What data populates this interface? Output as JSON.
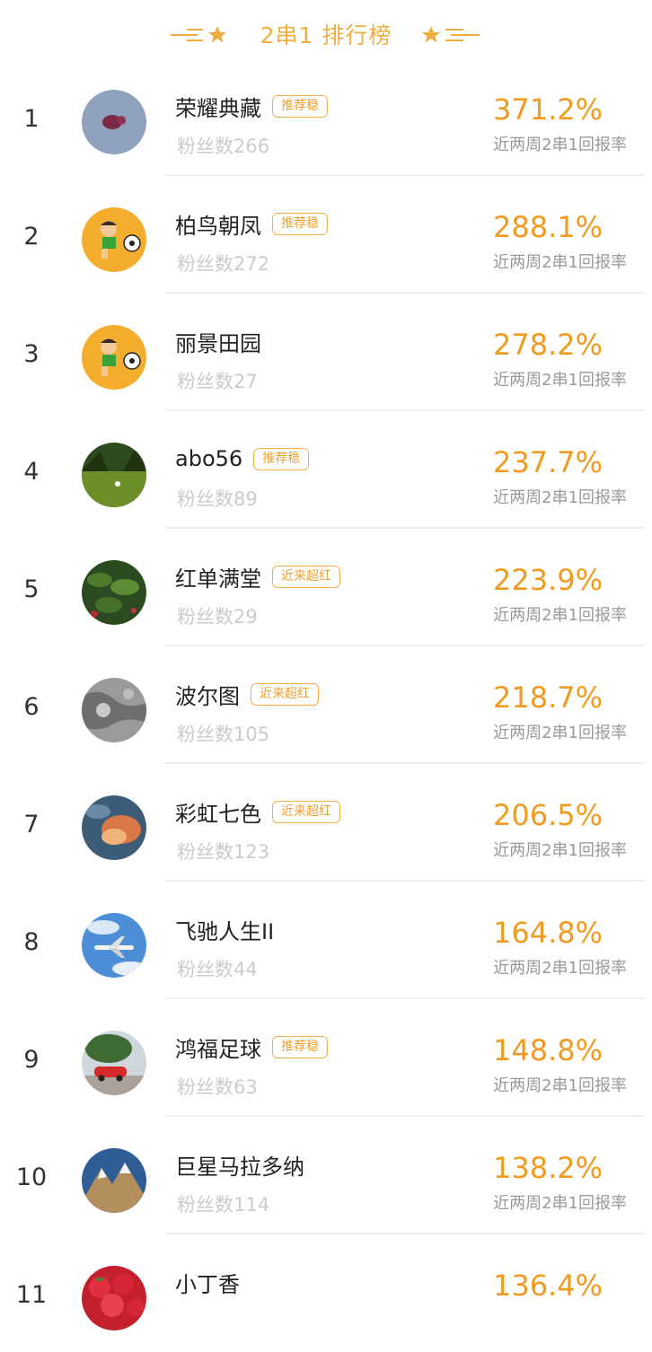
{
  "header": {
    "title": "2串1 排行榜"
  },
  "rate_label": "近近两周2串1回报率",
  "items": [
    {
      "rank": "1",
      "name": "荣耀典藏",
      "tag": "推荐稳",
      "fans": "粉丝数266",
      "rate": "371.2%",
      "rate_label": "近两周2串1回报率",
      "avatar": "pig-balloon-avatar-icon"
    },
    {
      "rank": "2",
      "name": "柏鸟朝凤",
      "tag": "推荐稳",
      "fans": "粉丝数272",
      "rate": "288.1%",
      "rate_label": "近两周2串1回报率",
      "avatar": "soccer-boy-avatar-icon"
    },
    {
      "rank": "3",
      "name": "丽景田园",
      "tag": "",
      "fans": "粉丝数27",
      "rate": "278.2%",
      "rate_label": "近两周2串1回报率",
      "avatar": "soccer-boy-avatar-icon"
    },
    {
      "rank": "4",
      "name": "abo56",
      "tag": "推荐稳",
      "fans": "粉丝数89",
      "rate": "237.7%",
      "rate_label": "近两周2串1回报率",
      "avatar": "field-avatar-icon"
    },
    {
      "rank": "5",
      "name": "红单满堂",
      "tag": "近来超红",
      "fans": "粉丝数29",
      "rate": "223.9%",
      "rate_label": "近两周2串1回报率",
      "avatar": "plant-avatar-icon"
    },
    {
      "rank": "6",
      "name": "波尔图",
      "tag": "近来超红",
      "fans": "粉丝数105",
      "rate": "218.7%",
      "rate_label": "近两周2串1回报率",
      "avatar": "stone-avatar-icon"
    },
    {
      "rank": "7",
      "name": "彩虹七色",
      "tag": "近来超红",
      "fans": "粉丝数123",
      "rate": "206.5%",
      "rate_label": "近两周2串1回报率",
      "avatar": "sunset-avatar-icon"
    },
    {
      "rank": "8",
      "name": "飞驰人生II",
      "tag": "",
      "fans": "粉丝数44",
      "rate": "164.8%",
      "rate_label": "近两周2串1回报率",
      "avatar": "airplane-avatar-icon"
    },
    {
      "rank": "9",
      "name": "鸿福足球",
      "tag": "推荐稳",
      "fans": "粉丝数63",
      "rate": "148.8%",
      "rate_label": "近两周2串1回报率",
      "avatar": "red-car-avatar-icon"
    },
    {
      "rank": "10",
      "name": "巨星马拉多纳",
      "tag": "",
      "fans": "粉丝数114",
      "rate": "138.2%",
      "rate_label": "近两周2串1回报率",
      "avatar": "mountain-avatar-icon"
    },
    {
      "rank": "11",
      "name": "小丁香",
      "tag": "",
      "fans": "",
      "rate": "136.4%",
      "rate_label": "",
      "avatar": "strawberry-avatar-icon"
    }
  ],
  "colors": {
    "accent": "#f29a1f",
    "tag_border": "#f3ad4c",
    "muted": "#cbcbcb",
    "label": "#999999"
  }
}
